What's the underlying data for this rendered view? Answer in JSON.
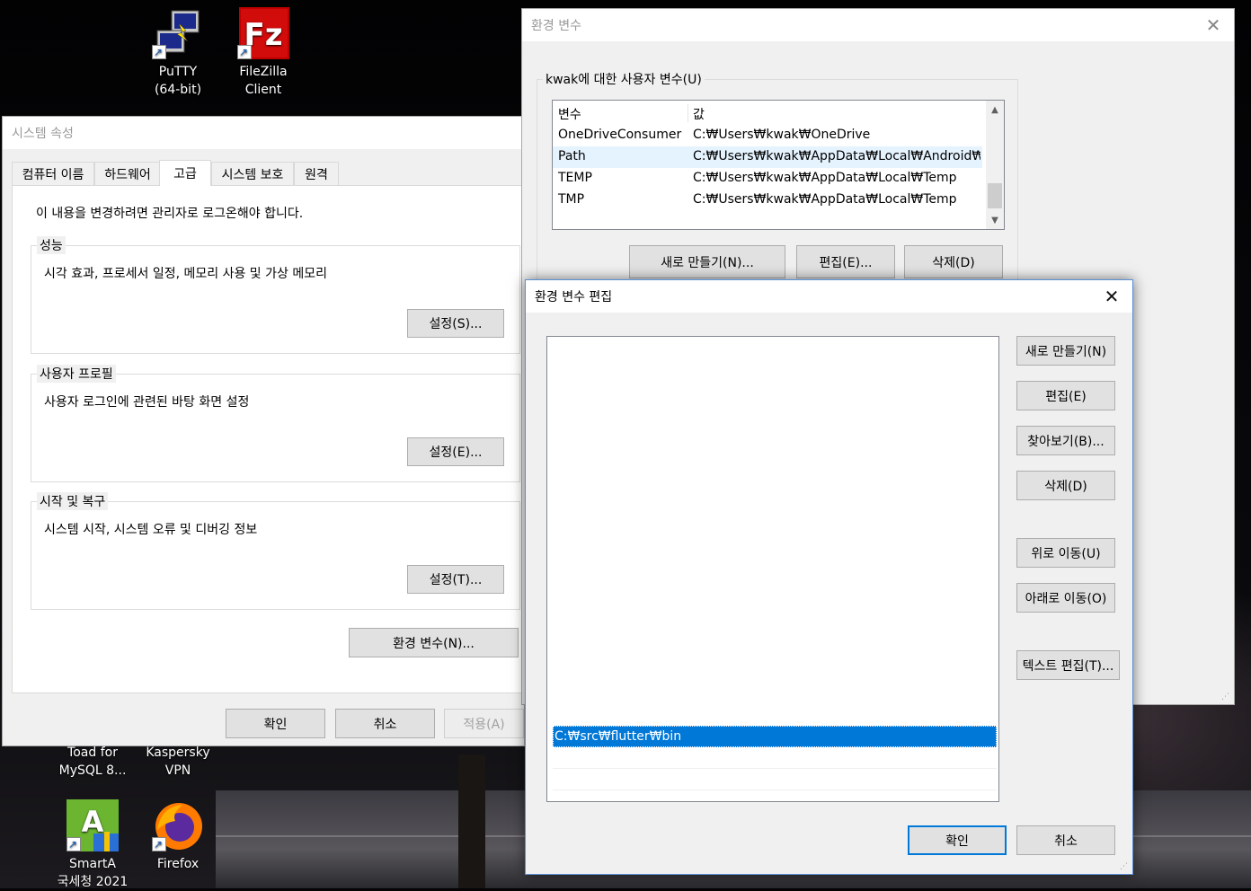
{
  "desktop": {
    "icons": [
      {
        "id": "putty",
        "line1": "PuTTY",
        "line2": "(64-bit)"
      },
      {
        "id": "filezilla",
        "line1": "FileZilla",
        "line2": "Client"
      },
      {
        "id": "toad",
        "line1": "Toad for",
        "line2": "MySQL 8..."
      },
      {
        "id": "kaspersky",
        "line1": "Kaspersky",
        "line2": "VPN"
      },
      {
        "id": "smarta",
        "line1": "SmartA",
        "line2": "국세청 2021"
      },
      {
        "id": "firefox",
        "line1": "Firefox",
        "line2": ""
      }
    ]
  },
  "system_props": {
    "title": "시스템 속성",
    "tabs": [
      "컴퓨터 이름",
      "하드웨어",
      "고급",
      "시스템 보호",
      "원격"
    ],
    "active_tab": 2,
    "admin_note": "이 내용을 변경하려면 관리자로 로그온해야 합니다.",
    "groups": [
      {
        "title": "성능",
        "desc": "시각 효과, 프로세서 일정, 메모리 사용 및 가상 메모리",
        "button": "설정(S)..."
      },
      {
        "title": "사용자 프로필",
        "desc": "사용자 로그인에 관련된 바탕 화면 설정",
        "button": "설정(E)..."
      },
      {
        "title": "시작 및 복구",
        "desc": "시스템 시작, 시스템 오류 및 디버깅 정보",
        "button": "설정(T)..."
      }
    ],
    "env_button": "환경 변수(N)...",
    "ok": "확인",
    "cancel": "취소",
    "apply": "적용(A)"
  },
  "env_vars": {
    "title": "환경 변수",
    "user_group_title": "kwak에 대한 사용자 변수(U)",
    "columns": [
      "변수",
      "값"
    ],
    "rows": [
      {
        "name": "OneDriveConsumer",
        "value": "C:₩Users₩kwak₩OneDrive"
      },
      {
        "name": "Path",
        "value": "C:₩Users₩kwak₩AppData₩Local₩Android₩S..."
      },
      {
        "name": "TEMP",
        "value": "C:₩Users₩kwak₩AppData₩Local₩Temp"
      },
      {
        "name": "TMP",
        "value": "C:₩Users₩kwak₩AppData₩Local₩Temp"
      }
    ],
    "new_button": "새로 만들기(N)...",
    "edit_button": "편집(E)...",
    "delete_button": "삭제(D)"
  },
  "edit_env": {
    "title": "환경 변수 편집",
    "selected_entry": "C:₩src₩flutter₩bin",
    "buttons": {
      "new": "새로 만들기(N)",
      "edit": "편집(E)",
      "browse": "찾아보기(B)...",
      "delete": "삭제(D)",
      "up": "위로 이동(U)",
      "down": "아래로 이동(O)",
      "text_edit": "텍스트 편집(T)..."
    },
    "ok": "확인",
    "cancel": "취소"
  }
}
